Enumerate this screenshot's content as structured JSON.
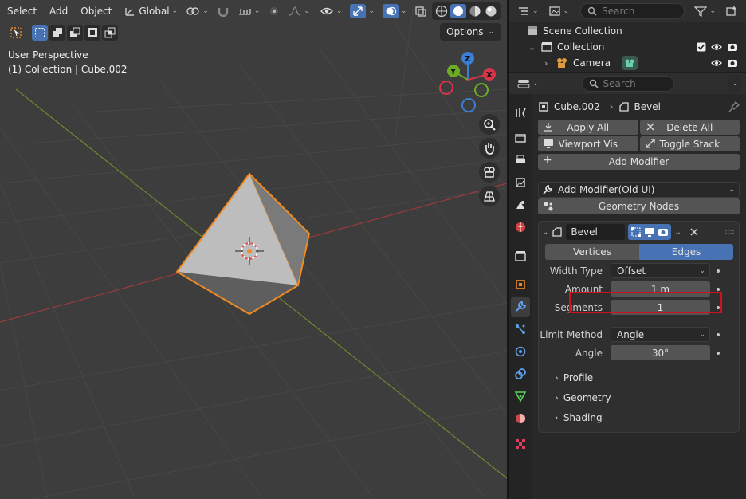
{
  "viewport": {
    "menu": [
      "Select",
      "Add",
      "Object"
    ],
    "transform_orientation": "Global",
    "options_label": "Options",
    "info_line1": "User Perspective",
    "info_line2": "(1) Collection | Cube.002",
    "gizmo": {
      "z": "Z",
      "y": "Y",
      "x": "X"
    }
  },
  "outliner": {
    "search_placeholder": "Search",
    "rows": [
      {
        "label": "Scene Collection"
      },
      {
        "label": "Collection"
      },
      {
        "label": "Camera"
      }
    ]
  },
  "properties": {
    "search_placeholder": "Search",
    "breadcrumb_object": "Cube.002",
    "breadcrumb_modifier": "Bevel",
    "apply_all": "Apply All",
    "delete_all": "Delete All",
    "viewport_vis": "Viewport Vis",
    "toggle_stack": "Toggle Stack",
    "add_modifier": "Add Modifier",
    "add_modifier_old": "Add Modifier(Old UI)",
    "geometry_nodes": "Geometry Nodes",
    "bevel": {
      "name": "Bevel",
      "tab_vertices": "Vertices",
      "tab_edges": "Edges",
      "width_type_label": "Width Type",
      "width_type_value": "Offset",
      "amount_label": "Amount",
      "amount_value": "1 m",
      "segments_label": "Segments",
      "segments_value": "1",
      "limit_method_label": "Limit Method",
      "limit_method_value": "Angle",
      "angle_label": "Angle",
      "angle_value": "30°",
      "sub_profile": "Profile",
      "sub_geometry": "Geometry",
      "sub_shading": "Shading"
    }
  },
  "colors": {
    "accent": "#4772b3",
    "highlight": "#d0121b",
    "selection": "#f08a24"
  }
}
